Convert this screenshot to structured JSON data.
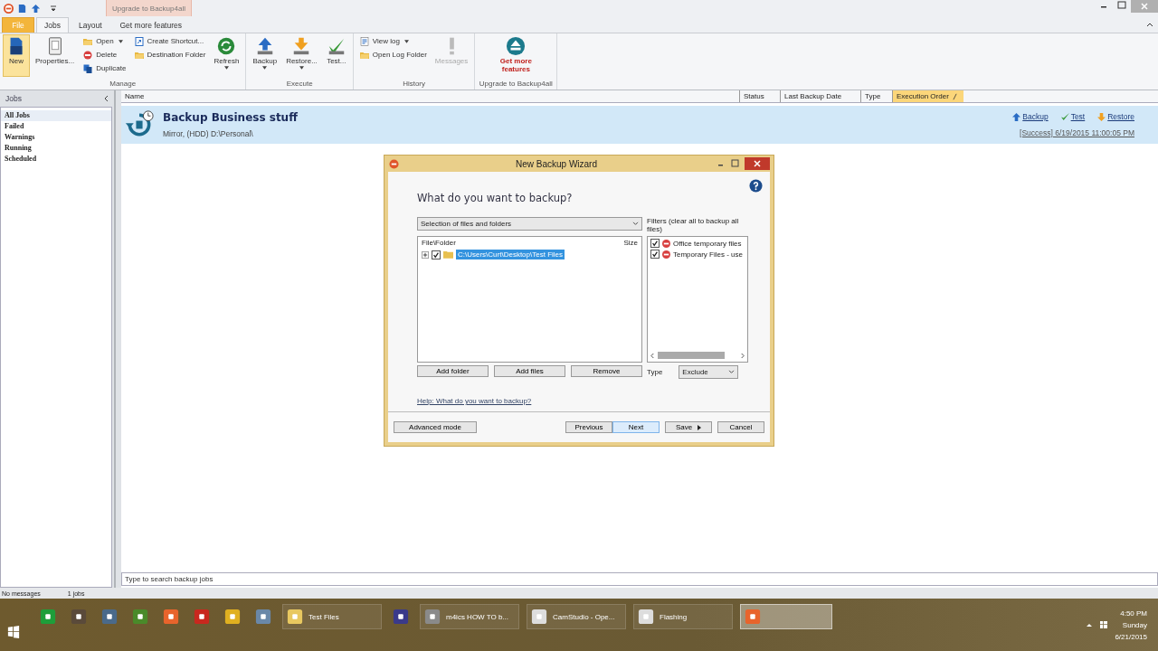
{
  "context_tab": {
    "label": "Upgrade to Backup4all"
  },
  "tabs": [
    {
      "label": "File",
      "kind": "file",
      "selected": false
    },
    {
      "label": "Jobs",
      "kind": "tab",
      "selected": true
    },
    {
      "label": "Layout",
      "kind": "tab",
      "selected": false
    },
    {
      "label": "Get more features",
      "kind": "tab",
      "selected": false
    }
  ],
  "ribbon_groups": [
    {
      "label": "Manage",
      "columns": [
        [
          {
            "label": "New",
            "kind": "large",
            "highlighted": true,
            "dropdown": false,
            "disabled": false
          }
        ],
        [
          {
            "label": "Properties...",
            "kind": "large",
            "highlighted": false,
            "dropdown": false,
            "disabled": false
          }
        ],
        [
          {
            "label": "Open",
            "kind": "small",
            "highlighted": false,
            "dropdown": true,
            "disabled": false
          },
          {
            "label": "Delete",
            "kind": "small",
            "highlighted": false,
            "dropdown": false,
            "disabled": false
          },
          {
            "label": "Duplicate",
            "kind": "small",
            "highlighted": false,
            "dropdown": false,
            "disabled": false
          }
        ],
        [
          {
            "label": "Create Shortcut...",
            "kind": "small",
            "highlighted": false,
            "dropdown": false,
            "disabled": false
          },
          {
            "label": "Destination Folder",
            "kind": "small",
            "highlighted": false,
            "dropdown": false,
            "disabled": false
          }
        ],
        [
          {
            "label": "Refresh",
            "kind": "large",
            "highlighted": false,
            "dropdown": true,
            "disabled": false
          }
        ]
      ]
    },
    {
      "label": "Execute",
      "columns": [
        [
          {
            "label": "Backup",
            "kind": "large",
            "highlighted": false,
            "dropdown": true,
            "disabled": false
          }
        ],
        [
          {
            "label": "Restore...",
            "kind": "large",
            "highlighted": false,
            "dropdown": true,
            "disabled": false
          }
        ],
        [
          {
            "label": "Test...",
            "kind": "large",
            "highlighted": false,
            "dropdown": false,
            "disabled": false
          }
        ]
      ]
    },
    {
      "label": "History",
      "columns": [
        [
          {
            "label": "View log",
            "kind": "small",
            "highlighted": false,
            "dropdown": true,
            "disabled": false
          },
          {
            "label": "Open Log Folder",
            "kind": "small",
            "highlighted": false,
            "dropdown": false,
            "disabled": false
          }
        ],
        [
          {
            "label": "Messages",
            "kind": "large",
            "highlighted": false,
            "dropdown": false,
            "disabled": true
          }
        ]
      ]
    },
    {
      "label": "Upgrade to Backup4all",
      "columns": [
        [
          {
            "label": "Get more features",
            "kind": "promo",
            "highlighted": false,
            "dropdown": false,
            "disabled": false
          }
        ]
      ]
    }
  ],
  "sidebar": {
    "title": "Jobs",
    "items": [
      {
        "label": "All Jobs",
        "selected": true
      },
      {
        "label": "Failed",
        "selected": false
      },
      {
        "label": "Warnings",
        "selected": false
      },
      {
        "label": "Running",
        "selected": false
      },
      {
        "label": "Scheduled",
        "selected": false
      }
    ]
  },
  "columns": [
    {
      "label": "Name",
      "sorted": false
    },
    {
      "label": "Status",
      "sorted": false
    },
    {
      "label": "Last Backup Date",
      "sorted": false
    },
    {
      "label": "Type",
      "sorted": false
    },
    {
      "label": "Execution Order",
      "sorted": true
    }
  ],
  "job": {
    "title": "Backup Business stuff",
    "subtitle": "Mirror, (HDD) D:\\Personal\\",
    "actions": [
      "Backup",
      "Test",
      "Restore"
    ],
    "status": "[Success] 6/19/2015 11:00:05 PM"
  },
  "search": {
    "placeholder": "Type to search backup jobs"
  },
  "status_bar": [
    "No messages",
    "1 jobs"
  ],
  "dialog": {
    "title": "New Backup Wizard",
    "question": "What do you want to backup?",
    "source": "Selection of files and folders",
    "filters_label": "Filters (clear all to backup all files)",
    "tree_columns": [
      "File\\Folder",
      "Size"
    ],
    "tree": [
      {
        "label": "C:\\Users\\Curt\\Desktop\\Test Files",
        "checked": true,
        "selected": true,
        "expanded": false
      }
    ],
    "filters": [
      {
        "label": "Office temporary files",
        "checked": true
      },
      {
        "label": "Temporary Files - use",
        "checked": true
      }
    ],
    "tree_buttons": [
      "Add folder",
      "Add files",
      "Remove"
    ],
    "type_label": "Type",
    "type_value": "Exclude",
    "help_link": "Help: What do you want to backup?",
    "footer_buttons": [
      {
        "label": "Advanced mode",
        "kind": "plain",
        "highlighted": false
      },
      {
        "label": "Previous",
        "kind": "plain",
        "highlighted": false
      },
      {
        "label": "Next",
        "kind": "plain",
        "highlighted": true
      },
      {
        "label": "Save",
        "kind": "menu",
        "highlighted": false
      },
      {
        "label": "Cancel",
        "kind": "plain",
        "highlighted": false
      }
    ]
  },
  "taskbar": {
    "apps": [
      {
        "color": "#1e9e3a",
        "active": false
      },
      {
        "color": "#5a4a3a",
        "active": false
      },
      {
        "color": "#4a6a8a",
        "active": false
      },
      {
        "color": "#4a8a2a",
        "active": false
      },
      {
        "color": "#e8642c",
        "active": false
      },
      {
        "color": "#c8281e",
        "active": false
      },
      {
        "color": "#e0b020",
        "active": false
      },
      {
        "color": "#6a88a8",
        "active": false
      },
      {
        "color": "#e8c860",
        "label": "Test Files",
        "active": false
      },
      {
        "color": "#3a3a8a",
        "active": false
      },
      {
        "color": "#8a8a8a",
        "label": "m4ics HOW TO b...",
        "active": false
      },
      {
        "color": "#dddddd",
        "label": "CamStudio - Ope...",
        "active": false
      },
      {
        "color": "#dddddd",
        "label": "Flashing",
        "active": false
      },
      {
        "color": "#e8642c",
        "active": true
      }
    ],
    "clock": [
      "4:50 PM",
      "Sunday",
      "6/21/2015"
    ]
  }
}
